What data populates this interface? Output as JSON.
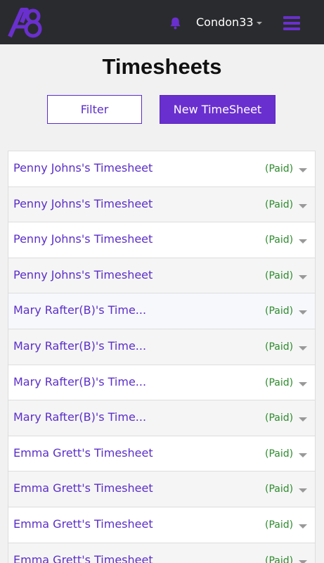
{
  "navbar": {
    "username": "Condon33",
    "accent": "#6a2fcf",
    "icons": {
      "logo": "app-logo",
      "bell": "bell-icon",
      "menu": "hamburger-icon"
    }
  },
  "page": {
    "title": "Timesheets"
  },
  "actions": {
    "filter_label": "Filter",
    "new_label": "New TimeSheet"
  },
  "timesheets": [
    {
      "name": "Penny Johns's Timesheet",
      "status": "(Paid)"
    },
    {
      "name": "Penny Johns's Timesheet",
      "status": "(Paid)"
    },
    {
      "name": "Penny Johns's Timesheet",
      "status": "(Paid)"
    },
    {
      "name": "Penny Johns's Timesheet",
      "status": "(Paid)"
    },
    {
      "name": "Mary Rafter(B)'s Time...",
      "status": "(Paid)"
    },
    {
      "name": "Mary Rafter(B)'s Time...",
      "status": "(Paid)"
    },
    {
      "name": "Mary Rafter(B)'s Time...",
      "status": "(Paid)"
    },
    {
      "name": "Mary Rafter(B)'s Time...",
      "status": "(Paid)"
    },
    {
      "name": "Emma Grett's Timesheet",
      "status": "(Paid)"
    },
    {
      "name": "Emma Grett's Timesheet",
      "status": "(Paid)"
    },
    {
      "name": "Emma Grett's Timesheet",
      "status": "(Paid)"
    },
    {
      "name": "Emma Grett's Timesheet",
      "status": "(Paid)"
    }
  ]
}
